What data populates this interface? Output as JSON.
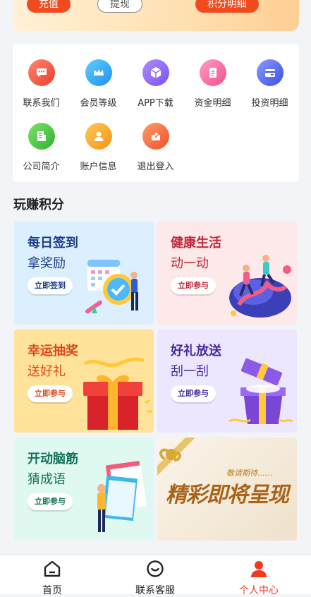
{
  "top": {
    "recharge": "充值",
    "withdraw": "提现",
    "points_detail": "积分明细"
  },
  "menu": {
    "items": [
      {
        "label": "联系我们",
        "icon": "chat-icon",
        "color": "#f2503c"
      },
      {
        "label": "会员等级",
        "icon": "crown-icon",
        "color": "#2ea3f2"
      },
      {
        "label": "APP下载",
        "icon": "box-icon",
        "color": "#8b63f1"
      },
      {
        "label": "资金明细",
        "icon": "document-icon",
        "color": "#f560a0"
      },
      {
        "label": "投资明细",
        "icon": "wallet-icon",
        "color": "#4f64ee"
      },
      {
        "label": "公司简介",
        "icon": "company-icon",
        "color": "#3cc23c"
      },
      {
        "label": "账户信息",
        "icon": "user-icon",
        "color": "#f5a01e"
      },
      {
        "label": "退出登入",
        "icon": "share-icon",
        "color": "#f5683a"
      }
    ]
  },
  "section_title": "玩赚积分",
  "tiles": [
    {
      "title": "每日签到",
      "sub": "拿奖励",
      "button": "立即签到",
      "bg": "#dcefff",
      "title_color": "#1a3d8a",
      "btn_color": "#1a3d8a"
    },
    {
      "title": "健康生活",
      "sub": "动一动",
      "button": "立即参与",
      "bg": "#fde8ea",
      "title_color": "#c02a3a",
      "btn_color": "#c02a3a"
    },
    {
      "title": "幸运抽奖",
      "sub": "送好礼",
      "button": "立即参与",
      "bg": "#ffe39a",
      "title_color": "#e0461a",
      "btn_color": "#e0461a"
    },
    {
      "title": "好礼放送",
      "sub": "刮一刮",
      "button": "立即参与",
      "bg": "#ece7ff",
      "title_color": "#4a2a9a",
      "btn_color": "#4a2a9a"
    },
    {
      "title": "开动脑筋",
      "sub": "猜成语",
      "button": "立即参与",
      "bg": "#dff8f0",
      "title_color": "#13725a",
      "btn_color": "#13725a"
    }
  ],
  "coming_soon": {
    "main": "精彩即将呈现",
    "small": "敬请期待……"
  },
  "nav": {
    "home": "首页",
    "service": "联系客服",
    "me": "个人中心",
    "active_color": "#f2391e"
  }
}
